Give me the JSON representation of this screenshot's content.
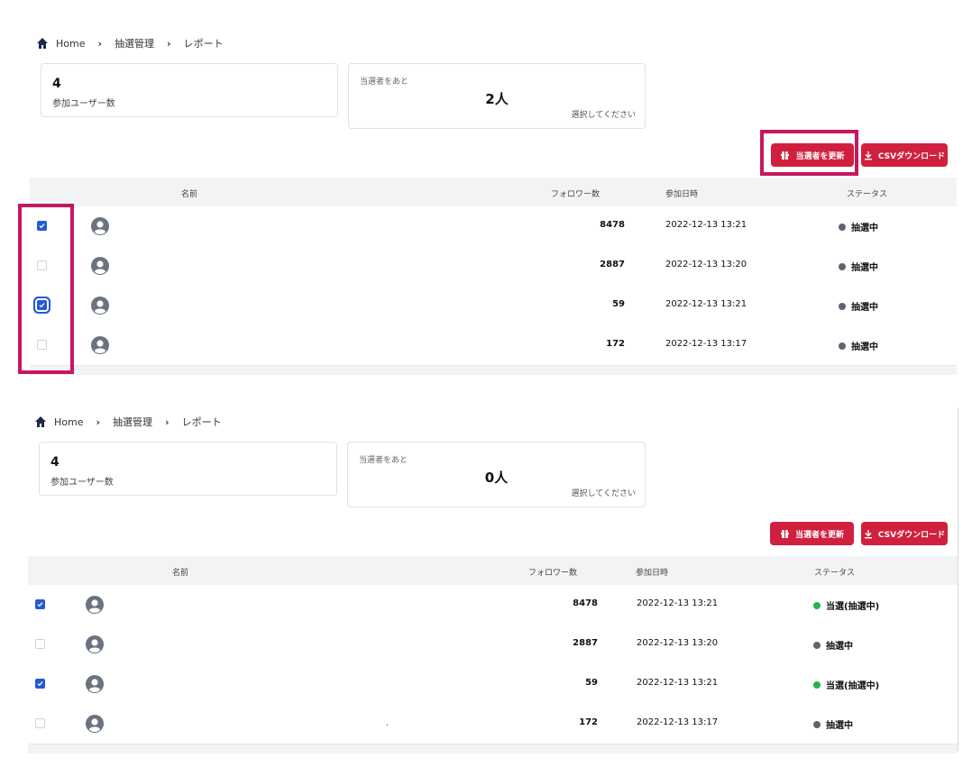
{
  "breadcrumb": {
    "home": "Home",
    "level1": "抽選管理",
    "level2": "レポート"
  },
  "panels": [
    {
      "count": {
        "value": "4",
        "label": "参加ユーザー数"
      },
      "remaining": {
        "label": "当選者をあと",
        "value": "2人",
        "hint": "選択してください"
      },
      "buttons": {
        "update": "当選者を更新",
        "csv": "CSVダウンロード"
      },
      "table": {
        "headers": [
          "名前",
          "フォロワー数",
          "参加日時",
          "ステータス"
        ],
        "rows": [
          {
            "checked": true,
            "followers": "8478",
            "date": "2022-12-13 13:21",
            "status": "抽選中"
          },
          {
            "checked": false,
            "followers": "2887",
            "date": "2022-12-13 13:20",
            "status": "抽選中"
          },
          {
            "checked": true,
            "followers": "59",
            "date": "2022-12-13 13:21",
            "status": "抽選中"
          },
          {
            "checked": false,
            "followers": "172",
            "date": "2022-12-13 13:17",
            "status": "抽選中"
          }
        ]
      }
    },
    {
      "count": {
        "value": "4",
        "label": "参加ユーザー数"
      },
      "remaining": {
        "label": "当選者をあと",
        "value": "0人",
        "hint": "選択してください"
      },
      "buttons": {
        "update": "当選者を更新",
        "csv": "CSVダウンロード"
      },
      "table": {
        "headers": [
          "名前",
          "フォロワー数",
          "参加日時",
          "ステータス"
        ],
        "rows": [
          {
            "checked": true,
            "followers": "8478",
            "date": "2022-12-13 13:21",
            "status": "当選(抽選中)"
          },
          {
            "checked": false,
            "followers": "2887",
            "date": "2022-12-13 13:20",
            "status": "抽選中"
          },
          {
            "checked": true,
            "followers": "59",
            "date": "2022-12-13 13:21",
            "status": "当選(抽選中)"
          },
          {
            "checked": false,
            "followers": "172",
            "date": "2022-12-13 13:17",
            "status": "抽選中"
          }
        ]
      }
    }
  ],
  "stray_mark": ".",
  "colors": {
    "accent": "#d1203f",
    "checkbox": "#2459d8",
    "status_pending": "#5e6472",
    "status_won": "#26b34a",
    "highlight": "#c7175e"
  }
}
